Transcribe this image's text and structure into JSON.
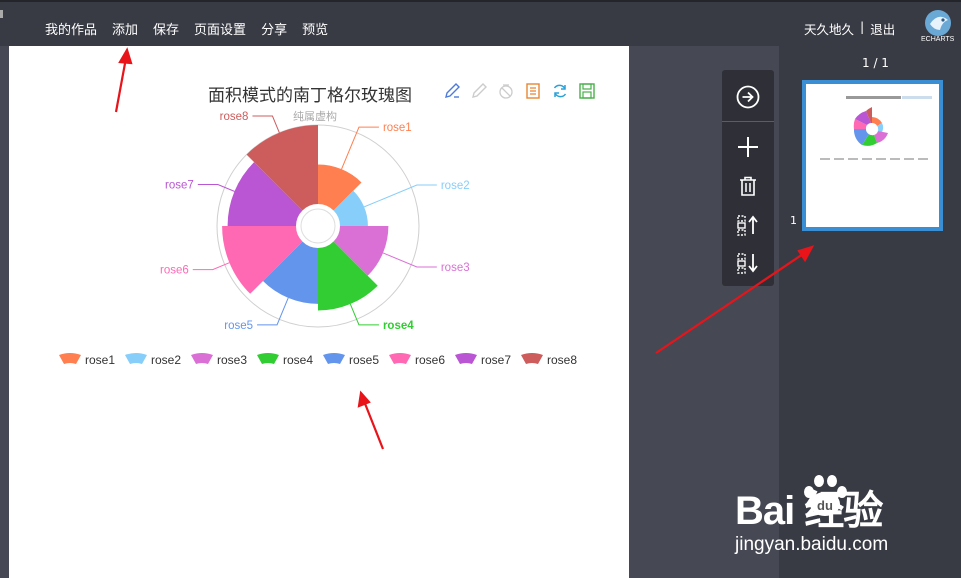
{
  "topbar": {
    "menu": [
      "我的作品",
      "添加",
      "保存",
      "页面设置",
      "分享",
      "预览"
    ],
    "user_name": "天久地久",
    "separator": "|",
    "logout": "退出",
    "logo_text": "ECHARTS"
  },
  "canvas": {
    "toolbox_icons": [
      "edit-pen-icon",
      "disabled-pen-icon",
      "disabled-erase-icon",
      "data-view-icon",
      "refresh-icon",
      "save-image-icon"
    ]
  },
  "chart_data": {
    "type": "nightingale-rose-area",
    "title": "面积模式的南丁格尔玫瑰图",
    "subtitle": "纯属虚构",
    "categories": [
      "rose1",
      "rose2",
      "rose3",
      "rose4",
      "rose5",
      "rose6",
      "rose7",
      "rose8"
    ],
    "values": [
      10,
      5,
      15,
      25,
      20,
      35,
      30,
      40
    ],
    "colors": [
      "#ff7f50",
      "#87cefa",
      "#da70d6",
      "#32cd32",
      "#6495ed",
      "#ff69b4",
      "#ba55d3",
      "#cd5c5c"
    ],
    "legend": [
      "rose1",
      "rose2",
      "rose3",
      "rose4",
      "rose5",
      "rose6",
      "rose7",
      "rose8"
    ],
    "legend_position": "bottom"
  },
  "side_tools": {
    "icons": [
      "next-arrow-icon",
      "add-icon",
      "trash-icon",
      "move-up-icon",
      "move-down-icon"
    ]
  },
  "pages": {
    "count_label": "1 / 1",
    "thumb_number": "1"
  },
  "watermark": {
    "brand": "Bai  经验",
    "url": "jingyan.baidu.com"
  },
  "annotations": {
    "arrow_color": "#e8141a"
  }
}
